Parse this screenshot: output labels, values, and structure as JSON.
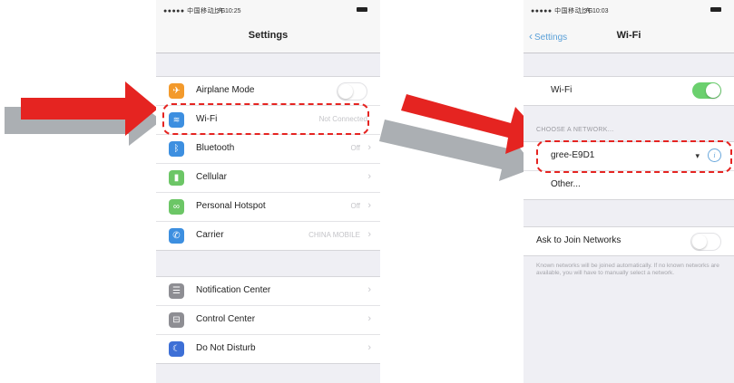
{
  "colors": {
    "arrow_red": "#e52421",
    "arrow_shadow": "#8f9499",
    "ios_blue": "#5aa0d8",
    "toggle_on": "#6bd06e"
  },
  "left": {
    "status": {
      "carrier": "●●●●● 中国移动 3G",
      "time": "上午10:25"
    },
    "title": "Settings",
    "group1": [
      {
        "label": "Airplane Mode",
        "icon": "airplane-icon",
        "icon_color": "#f39a2c",
        "toggle": false
      },
      {
        "label": "Wi-Fi",
        "icon": "wifi-icon",
        "icon_color": "#3d8fe0",
        "value": "Not Connected"
      },
      {
        "label": "Bluetooth",
        "icon": "bluetooth-icon",
        "icon_color": "#3d8fe0",
        "value": "Off"
      },
      {
        "label": "Cellular",
        "icon": "cellular-icon",
        "icon_color": "#6cc666"
      },
      {
        "label": "Personal Hotspot",
        "icon": "hotspot-icon",
        "icon_color": "#6cc666",
        "value": "Off"
      },
      {
        "label": "Carrier",
        "icon": "phone-icon",
        "icon_color": "#3d8fe0",
        "value": "CHINA MOBILE"
      }
    ],
    "group2": [
      {
        "label": "Notification Center",
        "icon": "notification-center-icon",
        "icon_color": "#8e8e93"
      },
      {
        "label": "Control Center",
        "icon": "control-center-icon",
        "icon_color": "#8e8e93"
      },
      {
        "label": "Do Not Disturb",
        "icon": "moon-icon",
        "icon_color": "#5856d6"
      }
    ]
  },
  "right": {
    "status": {
      "carrier": "●●●●● 中国移动 3G",
      "time": "上午10:03"
    },
    "back_label": "Settings",
    "title": "Wi-Fi",
    "wifi_row": {
      "label": "Wi-Fi",
      "toggle": true
    },
    "section_header": "CHOOSE A NETWORK...",
    "networks": [
      {
        "name": "gree-E9D1",
        "icon": "wifi-signal-icon"
      },
      {
        "name": "Other..."
      }
    ],
    "ask_row": {
      "label": "Ask to Join Networks",
      "toggle": false
    },
    "footnote": "Known networks will be joined automatically. If no known networks are available, you will have to manually select a network."
  }
}
